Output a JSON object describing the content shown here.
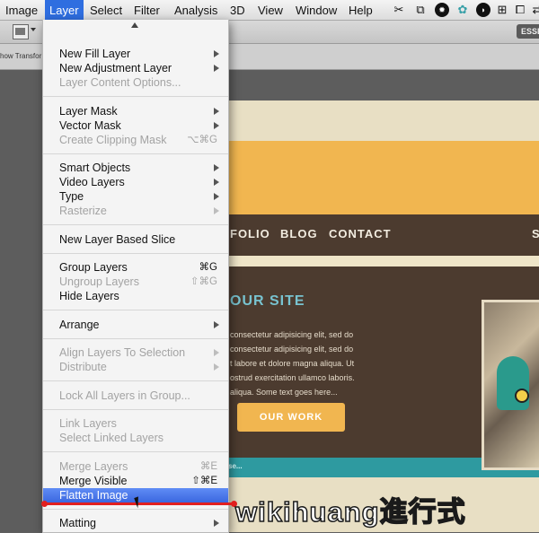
{
  "menubar": {
    "items": [
      "Image",
      "Layer",
      "Select",
      "Filter",
      "Analysis",
      "3D",
      "View",
      "Window",
      "Help"
    ],
    "active": "Layer"
  },
  "tray_icons": [
    "scissors-icon",
    "puzzle-icon",
    "soccer-ball-icon",
    "flower-icon",
    "shield-icon",
    "grid-icon",
    "window-icon",
    "arrows-icon"
  ],
  "optionsbar": {
    "workspace_label": "ESSE",
    "show_transform_label": "how Transfor"
  },
  "layer_menu": {
    "groups": [
      [
        {
          "label": "New Fill Layer",
          "submenu": true,
          "enabled": true
        },
        {
          "label": "New Adjustment Layer",
          "submenu": true,
          "enabled": true
        },
        {
          "label": "Layer Content Options...",
          "enabled": false
        }
      ],
      [
        {
          "label": "Layer Mask",
          "submenu": true,
          "enabled": true
        },
        {
          "label": "Vector Mask",
          "submenu": true,
          "enabled": true
        },
        {
          "label": "Create Clipping Mask",
          "shortcut": "⌥⌘G",
          "enabled": false
        }
      ],
      [
        {
          "label": "Smart Objects",
          "submenu": true,
          "enabled": true
        },
        {
          "label": "Video Layers",
          "submenu": true,
          "enabled": true
        },
        {
          "label": "Type",
          "submenu": true,
          "enabled": true
        },
        {
          "label": "Rasterize",
          "submenu": true,
          "enabled": false
        }
      ],
      [
        {
          "label": "New Layer Based Slice",
          "enabled": true
        }
      ],
      [
        {
          "label": "Group Layers",
          "shortcut": "⌘G",
          "enabled": true
        },
        {
          "label": "Ungroup Layers",
          "shortcut": "⇧⌘G",
          "enabled": false
        },
        {
          "label": "Hide Layers",
          "enabled": true
        }
      ],
      [
        {
          "label": "Arrange",
          "submenu": true,
          "enabled": true
        }
      ],
      [
        {
          "label": "Align Layers To Selection",
          "submenu": true,
          "enabled": false
        },
        {
          "label": "Distribute",
          "submenu": true,
          "enabled": false
        }
      ],
      [
        {
          "label": "Lock All Layers in Group...",
          "enabled": false
        }
      ],
      [
        {
          "label": "Link Layers",
          "enabled": false
        },
        {
          "label": "Select Linked Layers",
          "enabled": false
        }
      ],
      [
        {
          "label": "Merge Layers",
          "shortcut": "⌘E",
          "enabled": false
        },
        {
          "label": "Merge Visible",
          "shortcut": "⇧⌘E",
          "enabled": true
        },
        {
          "label": "Flatten Image",
          "enabled": true,
          "highlighted": true
        }
      ],
      [
        {
          "label": "Matting",
          "submenu": true,
          "enabled": true
        }
      ]
    ]
  },
  "document": {
    "nav_links": [
      "FOLIO",
      "BLOG",
      "CONTACT",
      "S"
    ],
    "hero_title": "OUR SITE",
    "hero_lines": [
      "consectetur adipisicing elit, sed do",
      "consectetur adipisicing elit, sed do",
      "t labore et dolore magna aliqua. Ut",
      "ostrud exercitation ullamco laboris.",
      "aliqua.  Some  text  goes     here..."
    ],
    "button_label": "OUR WORK",
    "teal_text": "se..."
  },
  "watermark": "wikihuang進行式"
}
